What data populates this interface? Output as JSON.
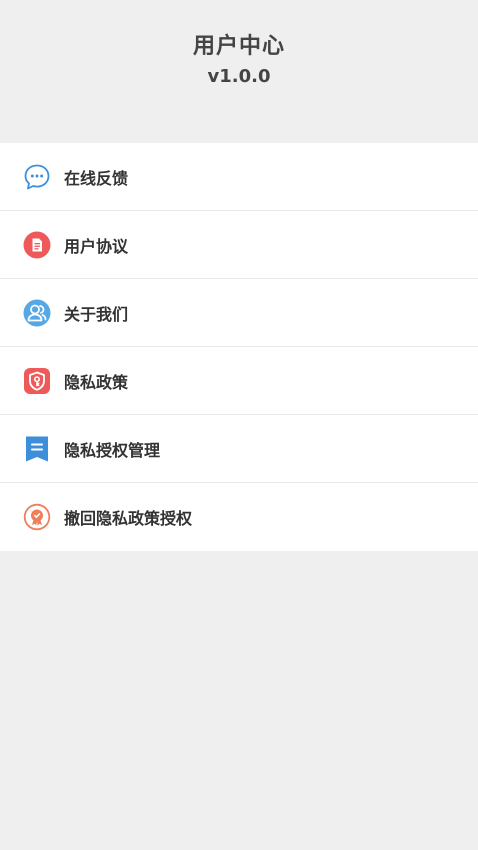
{
  "header": {
    "title": "用户中心",
    "version": "v1.0.0"
  },
  "menu": {
    "items": [
      {
        "label": "在线反馈",
        "icon": "chat-bubble-icon"
      },
      {
        "label": "用户协议",
        "icon": "document-icon"
      },
      {
        "label": "关于我们",
        "icon": "users-icon"
      },
      {
        "label": "隐私政策",
        "icon": "shield-key-icon"
      },
      {
        "label": "隐私授权管理",
        "icon": "bookmark-list-icon"
      },
      {
        "label": "撤回隐私政策授权",
        "icon": "badge-icon"
      }
    ]
  },
  "colors": {
    "background": "#efefef",
    "card": "#ffffff",
    "text": "#333333",
    "blue": "#3d8fdc",
    "red": "#ee5a5a",
    "orange": "#ee7f5a"
  }
}
